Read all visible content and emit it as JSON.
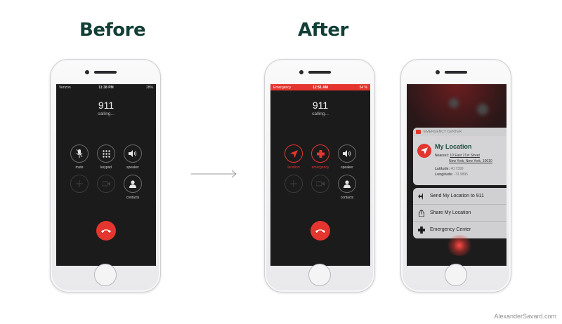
{
  "headings": {
    "before": "Before",
    "after": "After"
  },
  "credit": "AlexanderSavard.com",
  "phone_before": {
    "status": {
      "carrier": "Verizon",
      "time": "11:38 PM",
      "battery": "28%"
    },
    "number": "911",
    "call_status": "calling...",
    "buttons": [
      {
        "label": "mute",
        "icon": "mic-mute-icon"
      },
      {
        "label": "keypad",
        "icon": "keypad-icon"
      },
      {
        "label": "speaker",
        "icon": "speaker-icon"
      },
      {
        "label": "",
        "icon": "add-call-icon"
      },
      {
        "label": "",
        "icon": "facetime-icon"
      },
      {
        "label": "contacts",
        "icon": "contacts-icon"
      }
    ]
  },
  "phone_after_call": {
    "status": {
      "carrier": "Emergency",
      "time": "12:51 AM",
      "battery": "54 %"
    },
    "number": "911",
    "call_status": "calling...",
    "buttons": [
      {
        "label": "location",
        "icon": "location-arrow-icon"
      },
      {
        "label": "emergency",
        "icon": "medical-cross-icon"
      },
      {
        "label": "speaker",
        "icon": "speaker-icon"
      },
      {
        "label": "",
        "icon": "add-call-icon"
      },
      {
        "label": "",
        "icon": "facetime-icon"
      },
      {
        "label": "contacts",
        "icon": "contacts-icon"
      }
    ]
  },
  "phone_after_location": {
    "card_header": "EMERGENCY CENTER",
    "card_title": "My Location",
    "nearest_label": "Nearest:",
    "nearest_line1": "10 East 21st Street",
    "nearest_line2": "New York, New York, 10010",
    "latitude_label": "Latitude:",
    "latitude_value": "40.7399",
    "longitude_label": "Longitude:",
    "longitude_value": "-73.9895",
    "actions": [
      {
        "label": "Send My Location to 911",
        "icon": "send-location-icon"
      },
      {
        "label": "Share My Location",
        "icon": "share-icon"
      },
      {
        "label": "Emergency Center",
        "icon": "medical-cross-icon"
      }
    ]
  },
  "colors": {
    "heading": "#123f36",
    "accent_red": "#e4352e",
    "screen_bg": "#1b1b1c"
  }
}
